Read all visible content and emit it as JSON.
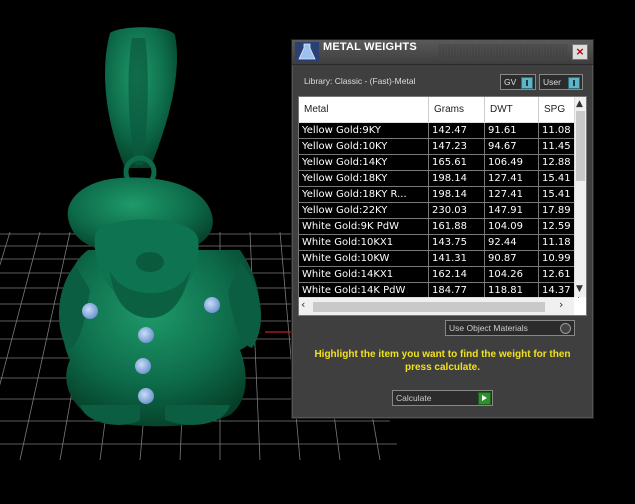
{
  "dialog": {
    "title": "METAL WEIGHTS",
    "close_symbol": "×",
    "library_label": "Library: Classic - (Fast)-Metal",
    "gv_label": "GV",
    "user_label": "User",
    "use_materials_label": "Use Object Materials",
    "instructions": "Highlight the item you want to find the weight for then press calculate.",
    "calculate_label": "Calculate",
    "icons": {
      "app": "flask-icon",
      "close": "close-icon",
      "scroll_up": "arrow-up-icon",
      "scroll_down": "arrow-down-icon",
      "scroll_left": "arrow-left-icon",
      "scroll_right": "arrow-right-icon",
      "calculate": "play-icon"
    },
    "arrows": {
      "up": "▲",
      "down": "▼",
      "left": "‹",
      "right": "›"
    }
  },
  "table": {
    "columns": [
      "Metal",
      "Grams",
      "DWT",
      "SPG"
    ],
    "rows": [
      {
        "metal": "Yellow Gold:9KY",
        "grams": "142.47",
        "dwt": "91.61",
        "spg": "11.08"
      },
      {
        "metal": "Yellow Gold:10KY",
        "grams": "147.23",
        "dwt": "94.67",
        "spg": "11.45"
      },
      {
        "metal": "Yellow Gold:14KY",
        "grams": "165.61",
        "dwt": "106.49",
        "spg": "12.88"
      },
      {
        "metal": "Yellow Gold:18KY",
        "grams": "198.14",
        "dwt": "127.41",
        "spg": "15.41"
      },
      {
        "metal": "Yellow Gold:18KY R...",
        "grams": "198.14",
        "dwt": "127.41",
        "spg": "15.41"
      },
      {
        "metal": "Yellow Gold:22KY",
        "grams": "230.03",
        "dwt": "147.91",
        "spg": "17.89"
      },
      {
        "metal": "White Gold:9K PdW",
        "grams": "161.88",
        "dwt": "104.09",
        "spg": "12.59"
      },
      {
        "metal": "White Gold:10KX1",
        "grams": "143.75",
        "dwt": "92.44",
        "spg": "11.18"
      },
      {
        "metal": "White Gold:10KW",
        "grams": "141.31",
        "dwt": "90.87",
        "spg": "10.99"
      },
      {
        "metal": "White Gold:14KX1",
        "grams": "162.14",
        "dwt": "104.26",
        "spg": "12.61"
      },
      {
        "metal": "White Gold:14K PdW",
        "grams": "184.77",
        "dwt": "118.81",
        "spg": "14.37"
      }
    ]
  },
  "colors": {
    "model_green": "#0d6b4a",
    "button_blue": "#8ab4e6",
    "instruction_yellow": "#f2e21b",
    "toggle_cyan": "#5fb4c6"
  }
}
